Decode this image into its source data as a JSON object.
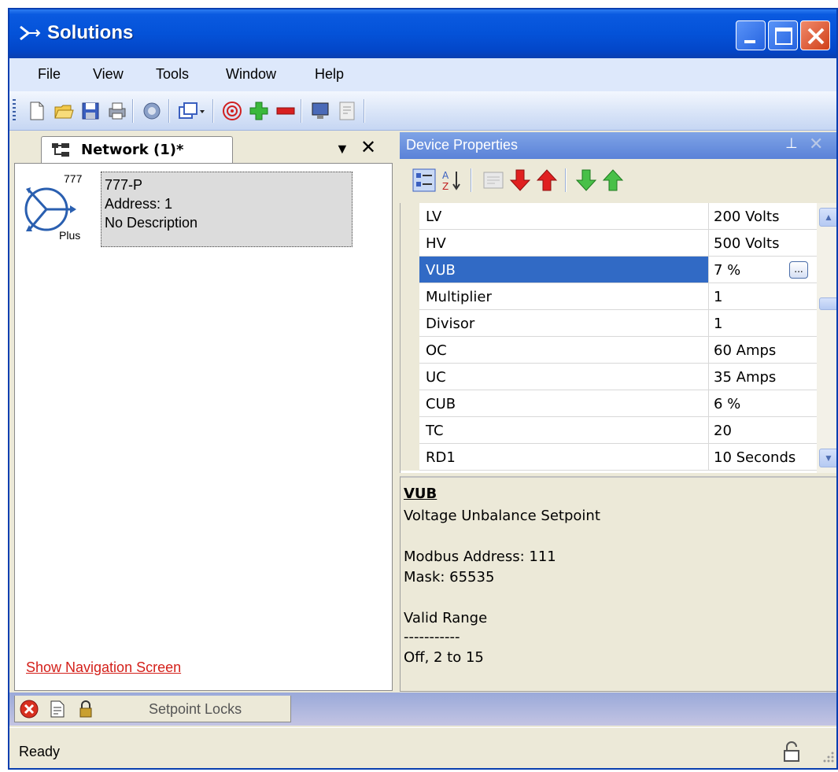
{
  "window": {
    "title": "Solutions",
    "icons": [
      "app-logo-icon",
      "minimize-icon",
      "maximize-icon",
      "close-icon"
    ]
  },
  "menu": [
    "File",
    "View",
    "Tools",
    "Window",
    "Help"
  ],
  "toolbar": {
    "icons": [
      "new-file-icon",
      "open-folder-icon",
      "save-icon",
      "print-icon",
      "network-icon",
      "window-dropdown-icon",
      "connect-icon",
      "add-icon",
      "remove-icon",
      "monitor-icon",
      "notes-icon"
    ]
  },
  "network_tab": {
    "label": "Network (1)*",
    "device": {
      "icon_top": "777",
      "icon_bottom": "Plus",
      "name": "777-P",
      "address": "Address: 1",
      "description": "No Description"
    },
    "nav_link": "Show Navigation Screen"
  },
  "device_properties": {
    "title": "Device Properties",
    "rows": [
      {
        "name": "LV",
        "value": "200 Volts"
      },
      {
        "name": "HV",
        "value": "500 Volts"
      },
      {
        "name": "VUB",
        "value": "7 %",
        "selected": true
      },
      {
        "name": "Multiplier",
        "value": "1"
      },
      {
        "name": "Divisor",
        "value": "1"
      },
      {
        "name": "OC",
        "value": "60 Amps"
      },
      {
        "name": "UC",
        "value": "35 Amps"
      },
      {
        "name": "CUB",
        "value": "6 %"
      },
      {
        "name": "TC",
        "value": "20"
      },
      {
        "name": "RD1",
        "value": "10 Seconds"
      }
    ],
    "ellipsis_label": "...",
    "description": {
      "title": "VUB",
      "subtitle": "Voltage Unbalance Setpoint",
      "modbus": "Modbus Address: 111",
      "mask": "Mask: 65535",
      "range_label": "Valid Range",
      "range_divider": "-----------",
      "range_value": "Off, 2 to 15"
    }
  },
  "bottom_tabs": {
    "setpoint_label": "Setpoint Locks"
  },
  "status": {
    "text": "Ready"
  },
  "colors": {
    "title_bar": "#0452d8",
    "selection": "#316ac5",
    "link": "#d4201a"
  }
}
